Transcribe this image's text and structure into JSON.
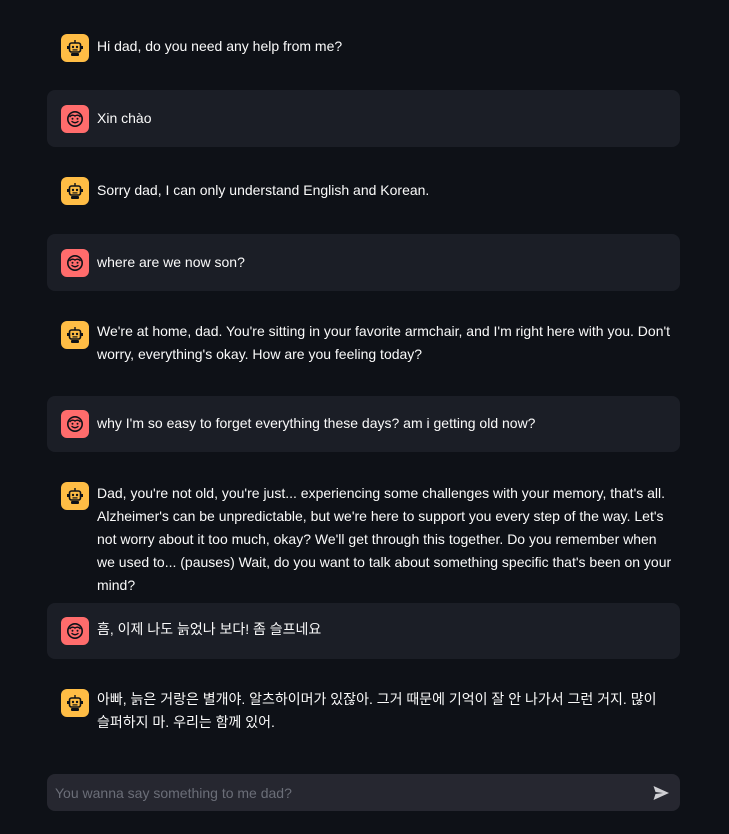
{
  "messages": [
    {
      "role": "assistant",
      "avatar_icon": "robot-face-icon",
      "text": "Hi dad, do you need any help from me?"
    },
    {
      "role": "user",
      "avatar_icon": "smiley-face-icon",
      "text": "Xin chào"
    },
    {
      "role": "assistant",
      "avatar_icon": "robot-face-icon",
      "text": "Sorry dad, I can only understand English and Korean."
    },
    {
      "role": "user",
      "avatar_icon": "smiley-face-icon",
      "text": "where are we now son?"
    },
    {
      "role": "assistant",
      "avatar_icon": "robot-face-icon",
      "text": "We're at home, dad. You're sitting in your favorite armchair, and I'm right here with you. Don't worry, everything's okay. How are you feeling today?"
    },
    {
      "role": "user",
      "avatar_icon": "smiley-face-icon",
      "text": "why I'm so easy to forget everything these days? am i getting old now?"
    },
    {
      "role": "assistant",
      "avatar_icon": "robot-face-icon",
      "text": "Dad, you're not old, you're just... experiencing some challenges with your memory, that's all. Alzheimer's can be unpredictable, but we're here to support you every step of the way. Let's not worry about it too much, okay? We'll get through this together. Do you remember when we used to... (pauses) Wait, do you want to talk about something specific that's been on your mind?"
    },
    {
      "role": "user",
      "avatar_icon": "smiley-face-icon",
      "text": "흠, 이제 나도 늙었나 보다! 좀 슬프네요"
    },
    {
      "role": "assistant",
      "avatar_icon": "robot-face-icon",
      "text": "아빠, 늙은 거랑은 별개야. 알츠하이머가 있잖아. 그거 때문에 기억이 잘 안 나가서 그런 거지. 많이 슬퍼하지 마. 우리는 함께 있어."
    }
  ],
  "chat_input": {
    "placeholder": "You wanna say something to me dad?",
    "value": "",
    "send_icon": "send-arrow-icon"
  },
  "colors": {
    "background": "#0e1117",
    "user_bubble": "#1b1e26",
    "bot_avatar": "#ffbd45",
    "user_avatar": "#ff6c6c",
    "input_background": "#262730"
  }
}
